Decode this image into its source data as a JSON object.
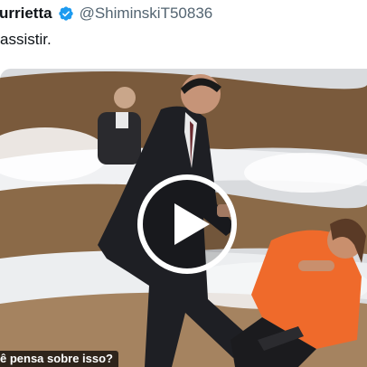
{
  "tweet": {
    "display_name": "urrietta",
    "verified_icon": "verified-badge-icon",
    "handle": "@ShiminskiT50836",
    "text": "assistir."
  },
  "media": {
    "type": "video",
    "play_icon": "play-icon",
    "caption": "ê pensa sobre isso?"
  },
  "colors": {
    "verified_blue": "#1d9bf0",
    "handle_gray": "#536471",
    "studio_wall": "#7a5a3c",
    "orange_blouse": "#ef6a2b"
  }
}
